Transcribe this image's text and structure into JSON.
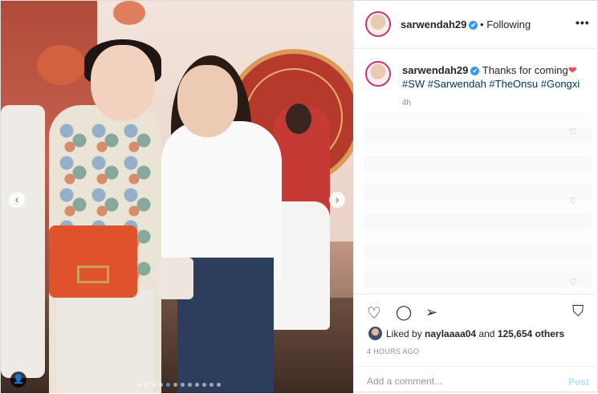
{
  "photo": {
    "prev_icon": "‹",
    "next_icon": "›",
    "user_tag_icon": "person-icon",
    "carousel_dots": [
      false,
      false,
      false,
      false,
      true,
      false,
      false,
      false,
      false,
      false,
      false,
      false
    ]
  },
  "header": {
    "username": "sarwendah29",
    "verified_icon": "✔",
    "separator": "•",
    "follow_status": "Following",
    "more_icon": "•••"
  },
  "caption": {
    "username": "sarwendah29",
    "verified_icon": "✔",
    "text": "Thanks for coming",
    "heart": "❤",
    "hashtags": [
      "#SW",
      "#Sarwendah",
      "#TheOnsu",
      "#Gongxi"
    ],
    "time": "4h"
  },
  "comment_likes": [
    "♡",
    "♡",
    "♡"
  ],
  "actions": {
    "like_icon": "♡",
    "comment_icon": "◯",
    "share_icon": "➢",
    "save_icon": "⛉"
  },
  "likes": {
    "prefix": "Liked by",
    "user": "naylaaaa04",
    "middle": "and",
    "count": "125,654 others"
  },
  "timestamp": "4 HOURS AGO",
  "add_comment": {
    "placeholder": "Add a comment...",
    "post_label": "Post"
  }
}
